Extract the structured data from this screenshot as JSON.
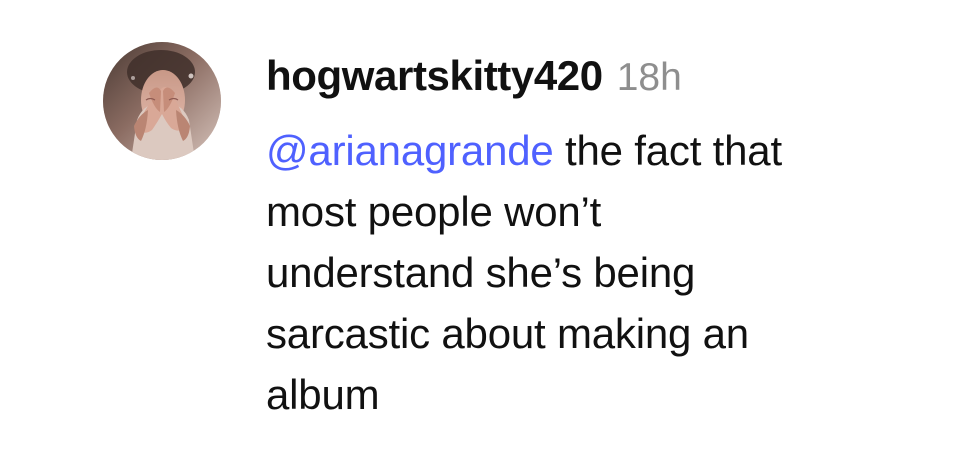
{
  "comment": {
    "username": "hogwartskitty420",
    "timestamp": "18h",
    "mention": "@arianagrande",
    "text_lines": [
      " the fact that",
      "most people won’t",
      "understand she’s being",
      "sarcastic about making an",
      "album"
    ],
    "mention_color": "#4f61ff",
    "timestamp_color": "#8e8e8e",
    "text_color": "#111111"
  }
}
